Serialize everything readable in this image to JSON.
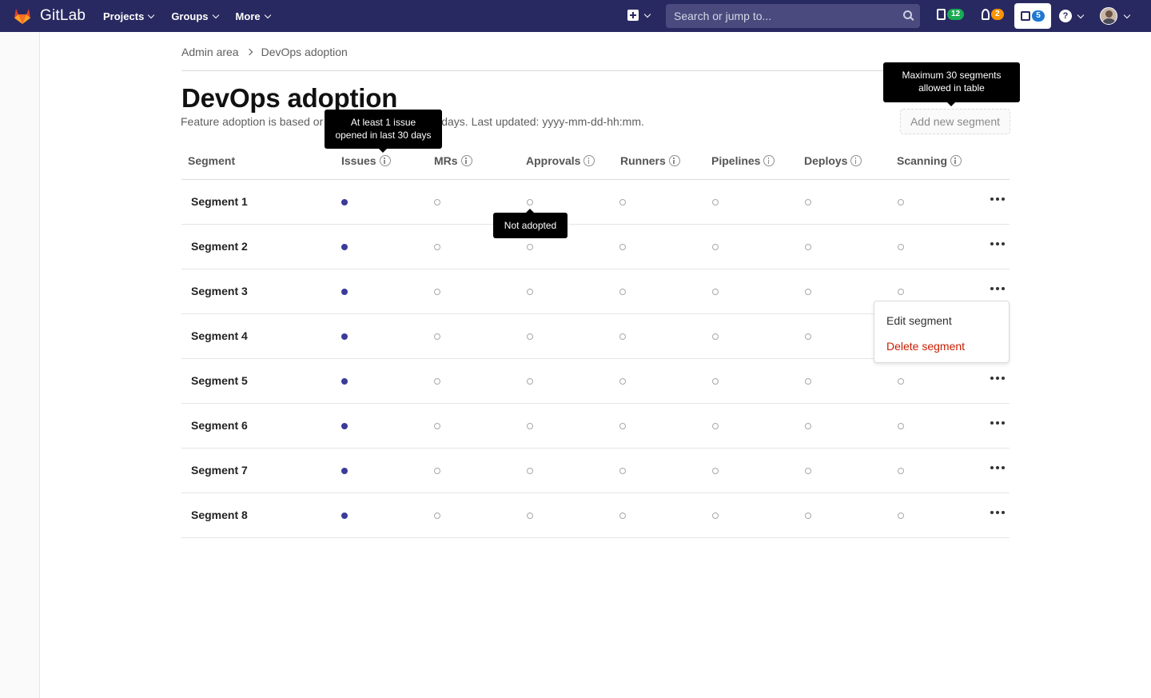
{
  "navbar": {
    "brand": "GitLab",
    "menu": [
      "Projects",
      "Groups",
      "More"
    ],
    "search_placeholder": "Search or jump to...",
    "issues_count": "12",
    "mrs_count": "2",
    "todos_count": "5",
    "colors": {
      "navbar": "#292961",
      "issues_badge": "#1aaa55",
      "mrs_badge": "#fc9403",
      "todos_badge": "#1f78d1"
    }
  },
  "breadcrumb": {
    "parent": "Admin area",
    "current": "DevOps adoption"
  },
  "page": {
    "title": "DevOps adoption",
    "description_start": "Feature adoption is based or",
    "description_end": "days. Last updated: yyyy-mm-dd-hh:mm.",
    "add_button": "Add new segment"
  },
  "tooltips": {
    "issues": [
      "At least 1 issue",
      "opened in last 30 days"
    ],
    "max_segments": [
      "Maximum 30 segments",
      "allowed in table"
    ],
    "not_adopted": "Not adopted"
  },
  "table": {
    "columns": [
      "Segment",
      "Issues",
      "MRs",
      "Approvals",
      "Runners",
      "Pipelines",
      "Deploys",
      "Scanning"
    ],
    "rows": [
      {
        "name": "Segment 1",
        "adopted": [
          true,
          false,
          false,
          false,
          false,
          false,
          false
        ]
      },
      {
        "name": "Segment 2",
        "adopted": [
          true,
          false,
          false,
          false,
          false,
          false,
          false
        ]
      },
      {
        "name": "Segment 3",
        "adopted": [
          true,
          false,
          false,
          false,
          false,
          false,
          false
        ]
      },
      {
        "name": "Segment 4",
        "adopted": [
          true,
          false,
          false,
          false,
          false,
          false,
          false
        ]
      },
      {
        "name": "Segment 5",
        "adopted": [
          true,
          false,
          false,
          false,
          false,
          false,
          false
        ]
      },
      {
        "name": "Segment 6",
        "adopted": [
          true,
          false,
          false,
          false,
          false,
          false,
          false
        ]
      },
      {
        "name": "Segment 7",
        "adopted": [
          true,
          false,
          false,
          false,
          false,
          false,
          false
        ]
      },
      {
        "name": "Segment 8",
        "adopted": [
          true,
          false,
          false,
          false,
          false,
          false,
          false
        ]
      }
    ]
  },
  "row_menu": {
    "edit": "Edit segment",
    "delete": "Delete segment"
  }
}
